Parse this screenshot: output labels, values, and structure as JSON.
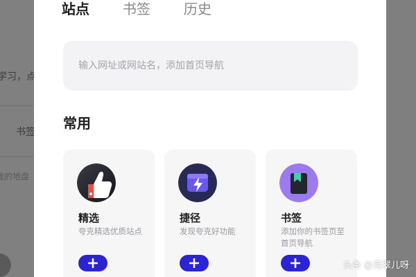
{
  "tabs": [
    {
      "label": "站点",
      "active": true
    },
    {
      "label": "书签",
      "active": false
    },
    {
      "label": "历史",
      "active": false
    }
  ],
  "search": {
    "placeholder": "输入网址或网站名，添加首页导航"
  },
  "section": {
    "title": "常用"
  },
  "cards": [
    {
      "title": "精选",
      "desc": "夸克精选优质站点",
      "icon": "thumbs-up-icon",
      "add_icon": "plus-icon"
    },
    {
      "title": "捷径",
      "desc": "发现夸克好功能",
      "icon": "lightning-icon",
      "add_icon": "plus-icon"
    },
    {
      "title": "书签",
      "desc": "添加你的书签页至首页导航",
      "icon": "bookmark-icon",
      "add_icon": "plus-icon"
    }
  ],
  "background": {
    "text1": "学习，点",
    "text2": "书签",
    "text3": "我的地盘"
  },
  "watermark": "头条 @范翠儿呀",
  "colors": {
    "accent": "#2a24d6",
    "card_bg": "#f6f6f7",
    "search_bg": "#f3f3f5"
  }
}
